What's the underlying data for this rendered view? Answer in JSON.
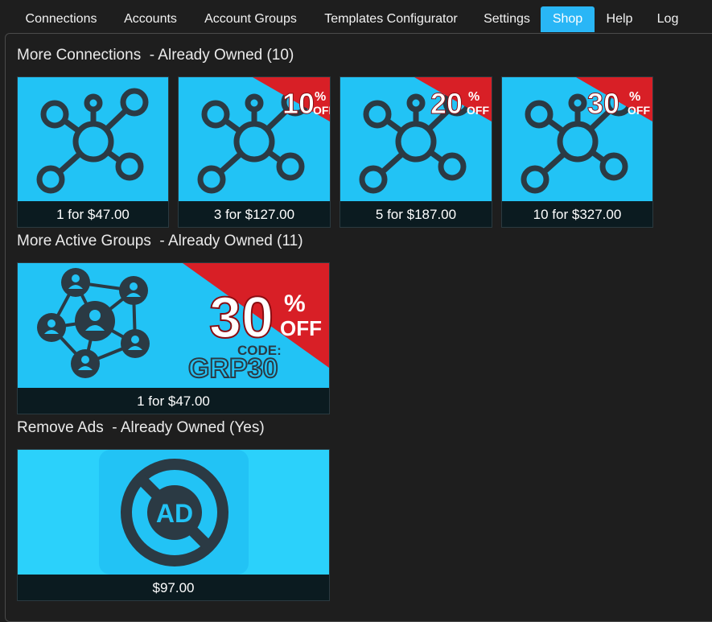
{
  "tabs": [
    {
      "label": "Connections"
    },
    {
      "label": "Accounts"
    },
    {
      "label": "Account Groups"
    },
    {
      "label": "Templates Configurator"
    },
    {
      "label": "Settings"
    },
    {
      "label": "Shop",
      "active": true
    },
    {
      "label": "Help"
    },
    {
      "label": "Log"
    }
  ],
  "sections": {
    "connections": {
      "title": "More Connections  - Already Owned (10)",
      "items": [
        {
          "price": "1 for $47.00",
          "discount": ""
        },
        {
          "price": "3 for $127.00",
          "discount": "10"
        },
        {
          "price": "5 for $187.00",
          "discount": "20"
        },
        {
          "price": "10 for $327.00",
          "discount": "30"
        }
      ]
    },
    "groups": {
      "title": "More Active Groups  - Already Owned (11)",
      "items": [
        {
          "price": "1 for $47.00",
          "discount": "30",
          "code_label": "CODE:",
          "code": "GRP30"
        }
      ]
    },
    "ads": {
      "title": "Remove Ads  - Already Owned (Yes)",
      "items": [
        {
          "price": "$97.00",
          "icon_text": "AD"
        }
      ]
    }
  },
  "badge": {
    "percent_sign": "%",
    "off": "OFF"
  },
  "colors": {
    "accent": "#29b6f6",
    "card_bg": "#22c3f5",
    "icon": "#2b3a44",
    "ribbon": "#d81f26",
    "price_bg": "#0b1b20"
  },
  "icons": {
    "connections": "network-hub-icon",
    "groups": "user-network-icon",
    "ads": "no-ads-icon"
  }
}
